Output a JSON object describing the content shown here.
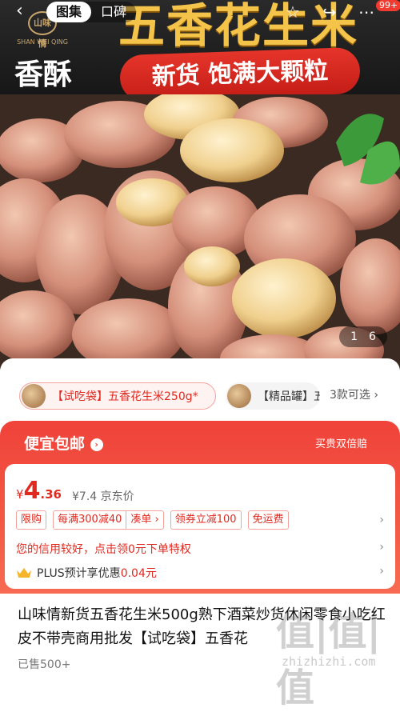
{
  "nav": {
    "tabs": [
      "图集",
      "口碑"
    ],
    "badge": "99+"
  },
  "hero": {
    "brand_seal": "山味情",
    "brand_text": "SHAN WEI QING",
    "big_title": "五香花生米",
    "side_title": "香酥入味",
    "ribbon": "新货 饱满大颗粒",
    "counter_current": "1",
    "counter_total": "6"
  },
  "variants": {
    "selected": "【试吃袋】五香花生米250g*",
    "other": "【精品罐】五",
    "more": "3款可选"
  },
  "deal": {
    "title": "便宜包邮",
    "guarantee": "买贵双倍赔",
    "currency": "¥",
    "price_int": "4",
    "price_dec": ".36",
    "orig_price": "¥7.4 京东价",
    "tags": [
      "限购",
      "每满300减40",
      "凑单 ›",
      "领券立减100",
      "免运费"
    ],
    "credit": "您的信用较好，点击领0元下单特权",
    "plus_prefix": "PLUS预计享优惠",
    "plus_value": "0.04元"
  },
  "product": {
    "title": "山味情新货五香花生米500g熟下酒菜炒货休闲零食小吃红皮不带壳商用批发【试吃袋】五香花",
    "sold": "已售500+"
  },
  "watermark": {
    "mark": "值|值|值",
    "url": "zhizhizhi.com"
  },
  "colors": {
    "accent_red": "#e02a20",
    "deal_red": "#f0423a"
  }
}
